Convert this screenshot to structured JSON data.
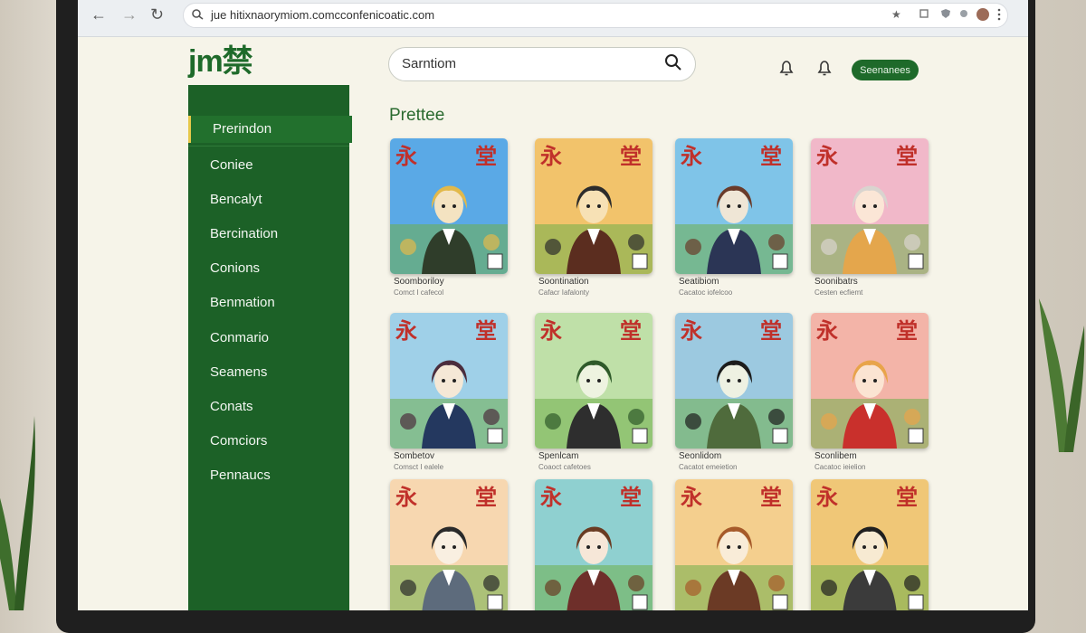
{
  "browser": {
    "url": "jue hitixnaorymiom.comcconfenicoatic.com",
    "back_glyph": "←",
    "forward_glyph": "→",
    "reload_glyph": "↻",
    "star_glyph": "★",
    "icons": [
      "back-icon",
      "forward-icon",
      "reload-icon",
      "site-info-icon",
      "star-icon",
      "extension-icon",
      "profile-avatar"
    ]
  },
  "header": {
    "logo": "jm禁",
    "search_text": "Sarntiom",
    "cta_label": "Seenanees"
  },
  "sidebar": {
    "items": [
      {
        "label": "Prerindon"
      },
      {
        "label": "Coniee"
      },
      {
        "label": "Bencalyt"
      },
      {
        "label": "Bercination"
      },
      {
        "label": "Conions"
      },
      {
        "label": "Benmation"
      },
      {
        "label": "Conmario"
      },
      {
        "label": "Seamens"
      },
      {
        "label": "Conats"
      },
      {
        "label": "Comciors"
      },
      {
        "label": "Pennaucs"
      }
    ]
  },
  "main": {
    "section_title": "Prettee",
    "cover_glyphs": [
      "永",
      "堂"
    ],
    "cards": [
      {
        "title": "Soomboriloy",
        "sub": "Comct I cafecol"
      },
      {
        "title": "Soontination",
        "sub": "Cafacr Iafalonty"
      },
      {
        "title": "Seatibiom",
        "sub": "Cacatoc iofelcoo"
      },
      {
        "title": "Soonibatrs",
        "sub": "Cesten ecfiemt"
      },
      {
        "title": "Sombetov",
        "sub": "Comsct I ealele"
      },
      {
        "title": "Spenlcam",
        "sub": "Coaoct cafetoes"
      },
      {
        "title": "Seonlidom",
        "sub": "Cacatot emeietion"
      },
      {
        "title": "Sconlibem",
        "sub": "Cacatoc ieielion"
      },
      {
        "title": "",
        "sub": ""
      },
      {
        "title": "",
        "sub": ""
      },
      {
        "title": "",
        "sub": ""
      },
      {
        "title": "",
        "sub": ""
      }
    ]
  },
  "colors": {
    "brand_green": "#1e6a2a",
    "sidebar_green": "#1c6127",
    "active_marker": "#e7c84a",
    "page_bg": "#f6f4e9"
  }
}
